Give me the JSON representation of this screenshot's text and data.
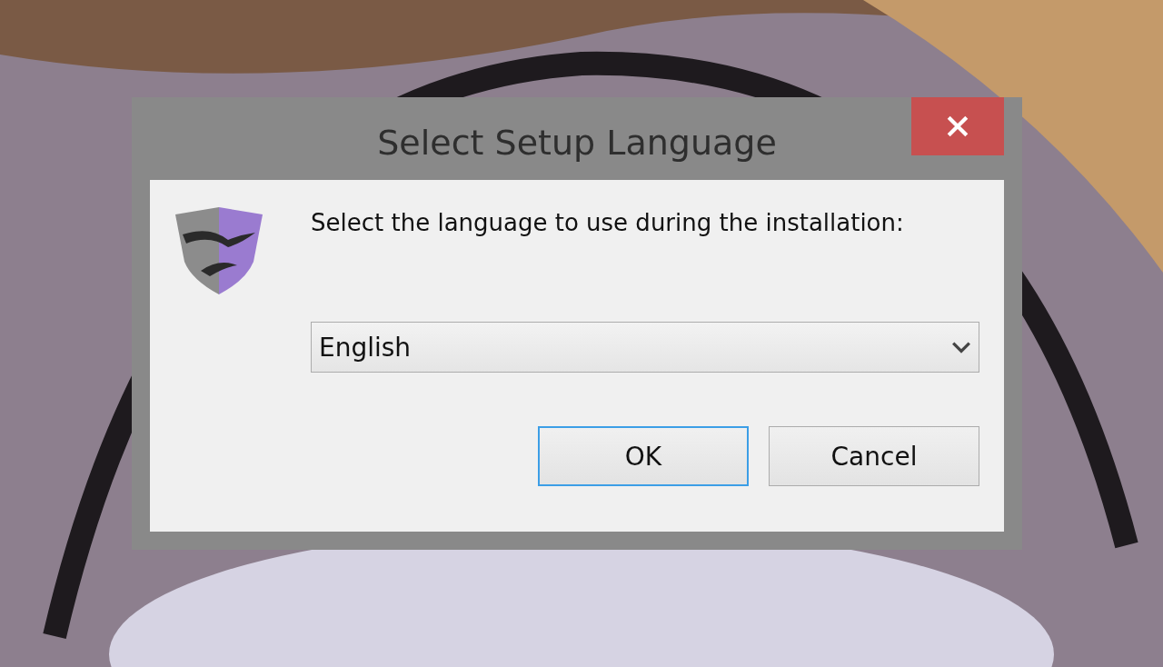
{
  "window": {
    "title": "Select Setup Language"
  },
  "prompt": "Select the language to use during the installation:",
  "language_select": {
    "value": "English"
  },
  "buttons": [
    {
      "label": "OK",
      "default": true
    },
    {
      "label": "Cancel",
      "default": false
    }
  ]
}
